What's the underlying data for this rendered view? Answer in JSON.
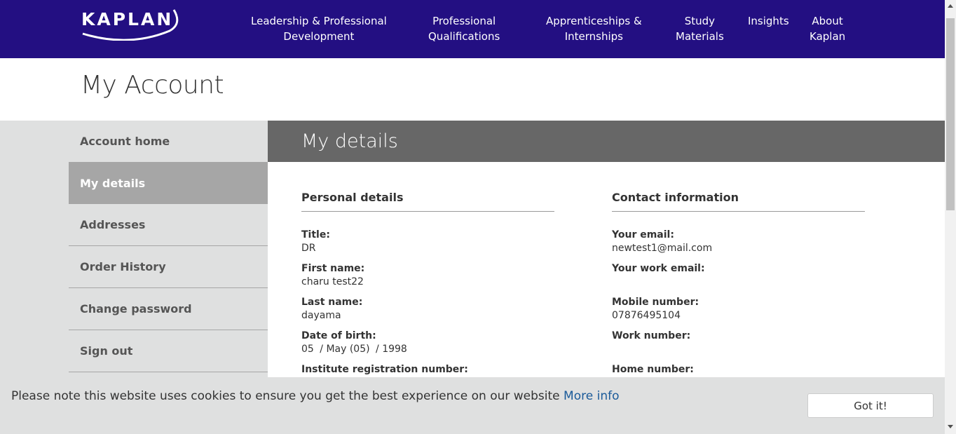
{
  "brand": {
    "logo_text": "KAPLAN",
    "primary_color": "#230f82",
    "link_color": "#1a5a99"
  },
  "nav": [
    {
      "line1": "Leadership & Professional",
      "line2": "Development"
    },
    {
      "line1": "Professional",
      "line2": "Qualifications"
    },
    {
      "line1": "Apprenticeships &",
      "line2": "Internships"
    },
    {
      "line1": "Study",
      "line2": "Materials"
    },
    {
      "line1": "Insights",
      "line2": ""
    },
    {
      "line1": "About",
      "line2": "Kaplan"
    }
  ],
  "page": {
    "title": "My Account"
  },
  "sidebar": {
    "items": [
      {
        "label": "Account home"
      },
      {
        "label": "My details",
        "active": true
      },
      {
        "label": "Addresses"
      },
      {
        "label": "Order History"
      },
      {
        "label": "Change password"
      },
      {
        "label": "Sign out"
      }
    ]
  },
  "main": {
    "header": "My details",
    "personal": {
      "title": "Personal details",
      "title_label": "Title:",
      "title_value": "DR",
      "first_name_label": "First name:",
      "first_name_value": "charu test22",
      "last_name_label": "Last name:",
      "last_name_value": "dayama",
      "dob_label": "Date of birth:",
      "dob_day": "05",
      "dob_month": "/ May (05)",
      "dob_year": "/ 1998",
      "institute_label": "Institute registration number:"
    },
    "contact": {
      "title": "Contact information",
      "email_label": "Your email:",
      "email_value": "newtest1@mail.com",
      "work_email_label": "Your work email:",
      "work_email_value": "",
      "mobile_label": "Mobile number:",
      "mobile_value": "07876495104",
      "work_number_label": "Work number:",
      "work_number_value": "",
      "home_number_label": "Home number:"
    }
  },
  "cookie": {
    "text": "Please note this website uses cookies to ensure you get the best experience on our website",
    "link": "More info",
    "button": "Got it!"
  }
}
